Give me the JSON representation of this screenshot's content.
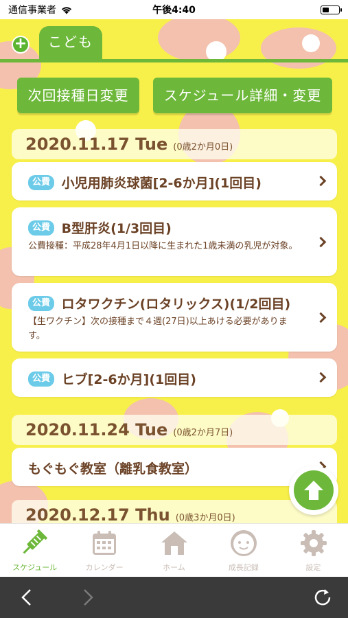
{
  "status": {
    "carrier": "通信事業者",
    "time": "午後4:40"
  },
  "tabs": {
    "add_label": "+",
    "active_tab": "こども"
  },
  "actions": {
    "next_date": "次回接種日変更",
    "detail": "スケジュール詳細・変更"
  },
  "schedule": [
    {
      "date": "2020.11.17 Tue",
      "age": "(0歳2か月0日)",
      "items": [
        {
          "badge": "公費",
          "title": "小児用肺炎球菌[2-6か月](1回目)",
          "desc": ""
        },
        {
          "badge": "公費",
          "title": "B型肝炎(1/3回目)",
          "desc": "公費接種：平成28年4月1日以降に生まれた1歳未満の乳児が対象。"
        },
        {
          "badge": "公費",
          "title": "ロタワクチン(ロタリックス)(1/2回目)",
          "desc": "【生ワクチン】次の接種まで４週(27日)以上あける必要があります。"
        },
        {
          "badge": "公費",
          "title": "ヒブ[2-6か月](1回目)",
          "desc": ""
        }
      ]
    },
    {
      "date": "2020.11.24 Tue",
      "age": "(0歳2か月7日)",
      "items": [
        {
          "badge": "",
          "title": "もぐもぐ教室（離乳食教室）",
          "desc": ""
        }
      ]
    },
    {
      "date": "2020.12.17 Thu",
      "age": "(0歳3か月0日)",
      "items": []
    }
  ],
  "nav": {
    "items": [
      {
        "label": "スケジュール",
        "icon": "syringe-icon",
        "active": true
      },
      {
        "label": "カレンダー",
        "icon": "calendar-icon",
        "active": false
      },
      {
        "label": "ホーム",
        "icon": "home-icon",
        "active": false
      },
      {
        "label": "成長記録",
        "icon": "baby-face-icon",
        "active": false
      },
      {
        "label": "設定",
        "icon": "gear-icon",
        "active": false
      }
    ]
  },
  "browser": {
    "back_icon": "back-arrow-icon",
    "forward_icon": "forward-arrow-icon",
    "reload_icon": "reload-icon"
  },
  "colors": {
    "background": "#f8f04a",
    "accent": "#6db83a",
    "badge": "#6ccbe8",
    "text": "#6b4226"
  }
}
